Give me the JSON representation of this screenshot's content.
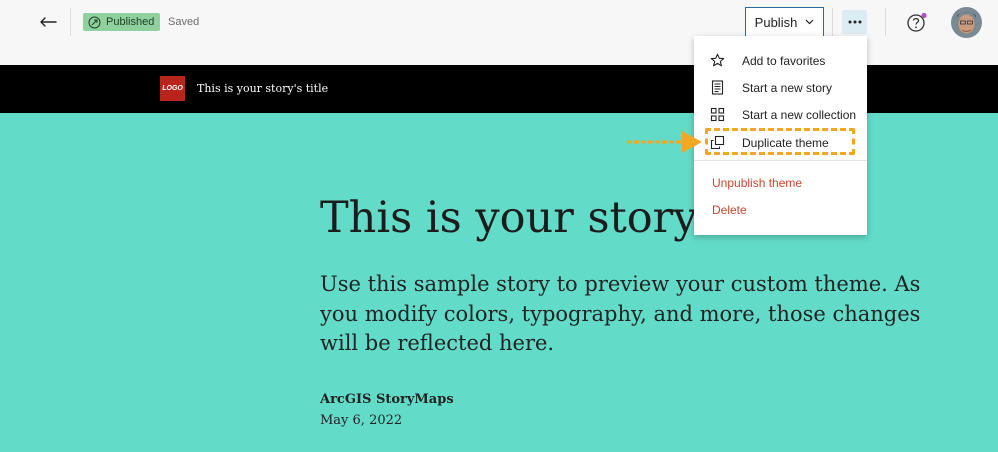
{
  "topbar": {
    "status_badge": "Published",
    "saved_label": "Saved",
    "publish_label": "Publish"
  },
  "story_header": {
    "logo_text": "LOGO",
    "title": "This is your story's title"
  },
  "hero": {
    "title": "This is your story’s title",
    "subtitle": "Use this sample story to preview your custom theme. As you modify colors, typography, and more, those changes will be reflected here.",
    "byline": "ArcGIS StoryMaps",
    "date": "May 6, 2022"
  },
  "menu": {
    "items": [
      {
        "label": "Add to favorites",
        "icon": "star-icon"
      },
      {
        "label": "Start a new story",
        "icon": "document-icon"
      },
      {
        "label": "Start a new collection",
        "icon": "grid-icon"
      },
      {
        "label": "Duplicate theme",
        "icon": "duplicate-icon"
      }
    ],
    "danger_items": [
      {
        "label": "Unpublish theme"
      },
      {
        "label": "Delete"
      }
    ]
  },
  "colors": {
    "hero_bg": "#63dbc9",
    "badge_bg": "#8fd19e",
    "highlight": "#f5a623",
    "danger": "#c8462e",
    "publish_border": "#2a6b9a"
  }
}
